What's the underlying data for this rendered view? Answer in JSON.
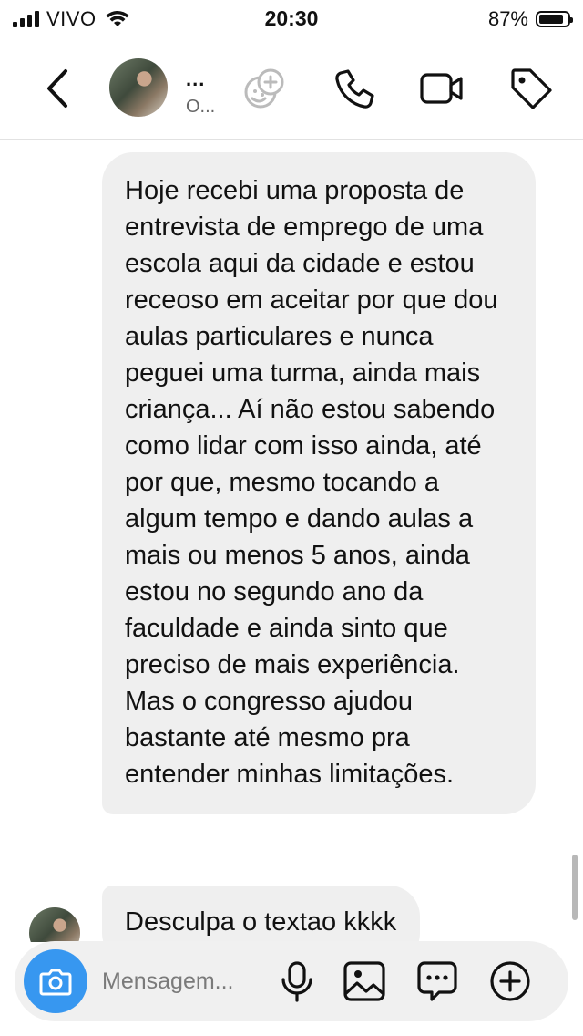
{
  "status_bar": {
    "carrier": "VIVO",
    "time": "20:30",
    "battery": "87%",
    "battery_level": 0.87
  },
  "header": {
    "contact_name": "...",
    "contact_subtitle": "O...",
    "icons": [
      "chevron-left-icon",
      "effects-icon",
      "phone-icon",
      "video-camera-icon",
      "tag-icon"
    ]
  },
  "messages": [
    {
      "text": "Hoje recebi uma proposta de entrevista de emprego de uma escola aqui da cidade e estou receoso em aceitar por que dou aulas particulares e nunca peguei uma turma, ainda mais criança... Aí não estou sabendo como lidar com isso ainda, até por que, mesmo tocando a algum tempo e dando aulas a mais ou menos 5 anos, ainda estou no segundo ano da faculdade e ainda sinto que preciso de mais experiência. Mas o congresso ajudou bastante até mesmo pra entender minhas limitações."
    },
    {
      "text": "Desculpa o textao kkkk"
    }
  ],
  "composer": {
    "placeholder": "Mensagem...",
    "accent_color": "#3797f0",
    "icons": [
      "camera-icon",
      "microphone-icon",
      "gallery-icon",
      "sticker-icon",
      "plus-icon"
    ]
  }
}
